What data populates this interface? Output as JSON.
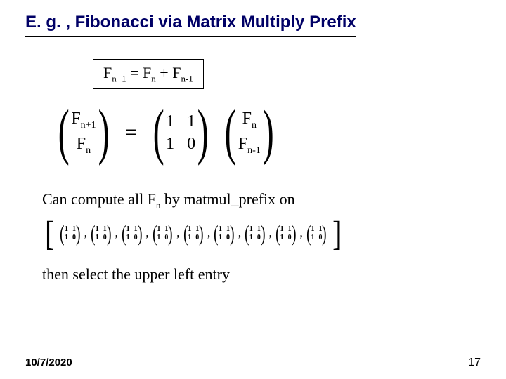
{
  "title": "E. g. , Fibonacci via Matrix Multiply Prefix",
  "recurrence": {
    "lhs_base": "F",
    "lhs_sub": "n+1",
    "eq": " = ",
    "t1_base": "F",
    "t1_sub": "n",
    "plus": "  +  ",
    "t2_base": "F",
    "t2_sub": "n-1"
  },
  "matrix_eq": {
    "lhs": {
      "a_base": "F",
      "a_sub": "n+1",
      "b_base": "F",
      "b_sub": "n"
    },
    "eq": "=",
    "M": {
      "r1c1": "1",
      "r1c2": "1",
      "r2c1": "1",
      "r2c2": "0"
    },
    "rhs": {
      "a_base": "F",
      "a_sub": "n",
      "b_base": "F",
      "b_sub": "n-1"
    }
  },
  "body": {
    "line1a": "Can compute all F",
    "line1_sub": "n",
    "line1b": " by matmul_prefix on",
    "then": "then select the upper left entry"
  },
  "smat": {
    "r1c1": "1",
    "r1c2": "1",
    "r2c1": "1",
    "r2c2": "0"
  },
  "array_count": 9,
  "footer": {
    "date": "10/7/2020",
    "page": "17"
  }
}
